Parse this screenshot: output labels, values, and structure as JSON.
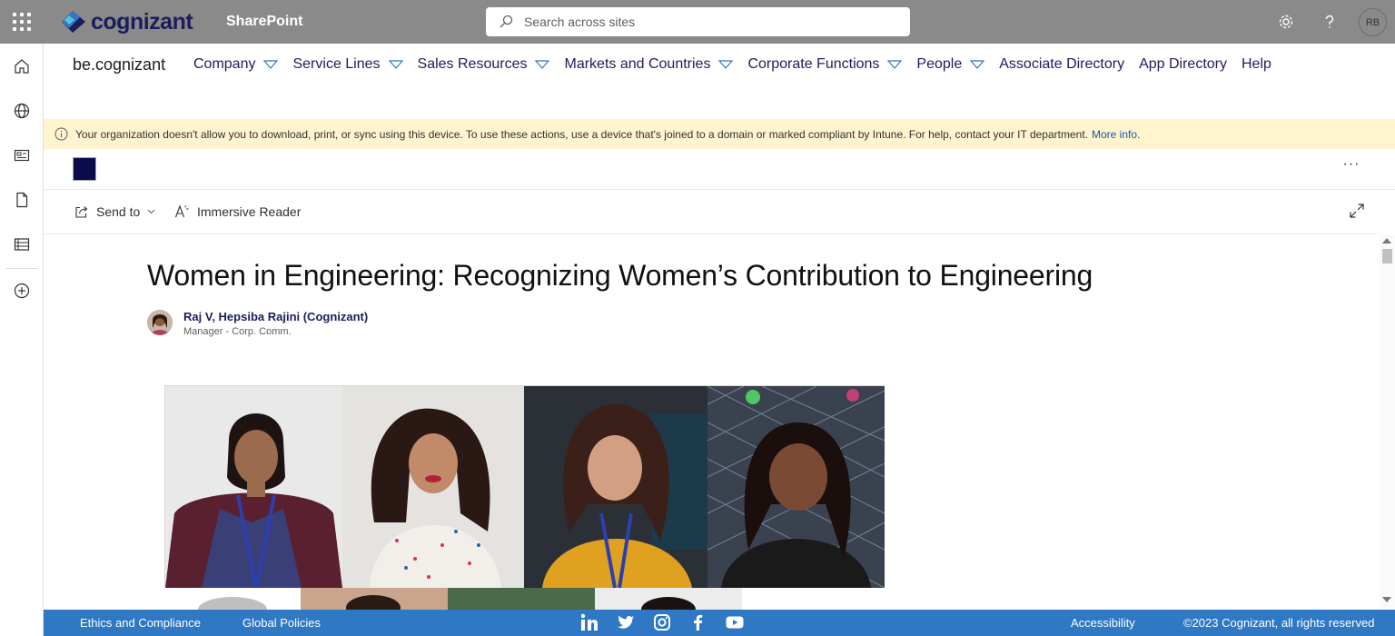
{
  "suitebar": {
    "logo_text": "cognizant",
    "app_name": "SharePoint",
    "search_placeholder": "Search across sites",
    "avatar_initials": "RB"
  },
  "hub": {
    "site_title": "be.cognizant",
    "nav": [
      {
        "label": "Company",
        "dropdown": true
      },
      {
        "label": "Service Lines",
        "dropdown": true
      },
      {
        "label": "Sales Resources",
        "dropdown": true
      },
      {
        "label": "Markets and Countries",
        "dropdown": true
      },
      {
        "label": "Corporate Functions",
        "dropdown": true
      },
      {
        "label": "People",
        "dropdown": true
      },
      {
        "label": "Associate Directory",
        "dropdown": false
      },
      {
        "label": "App Directory",
        "dropdown": false
      },
      {
        "label": "Help",
        "dropdown": false
      }
    ]
  },
  "banner": {
    "text": "Your organization doesn't allow you to download, print, or sync using this device. To use these actions, use a device that's joined to a domain or marked compliant by Intune. For help, contact your IT department.",
    "link": "More info."
  },
  "commands": {
    "send_to": "Send to",
    "immersive_reader": "Immersive Reader"
  },
  "article": {
    "title": "Women in Engineering: Recognizing Women’s Contribution to Engineering",
    "author_name": "Raj V, Hepsiba Rajini (Cognizant)",
    "author_role": "Manager - Corp. Comm."
  },
  "footer": {
    "ethics": "Ethics and Compliance",
    "policies": "Global Policies",
    "accessibility": "Accessibility",
    "copyright": "©2023 Cognizant, all rights reserved"
  },
  "colors": {
    "suitebar": "#8a8a8a",
    "brand_navy": "#1b1d5c",
    "banner_bg": "#fff4ce",
    "footer_bg": "#2f78c4",
    "link": "#0f5ba7"
  }
}
